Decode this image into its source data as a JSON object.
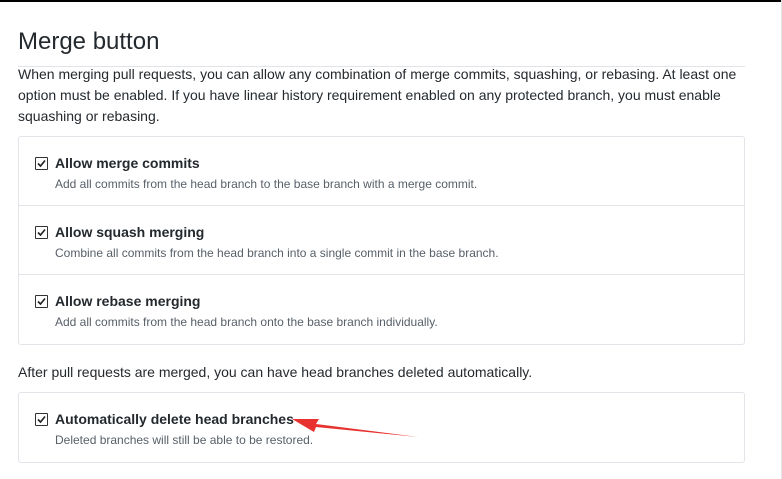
{
  "section": {
    "title": "Merge button",
    "description": "When merging pull requests, you can allow any combination of merge commits, squashing, or rebasing. At least one option must be enabled. If you have linear history requirement enabled on any protected branch, you must enable squashing or rebasing."
  },
  "merge_options": [
    {
      "label": "Allow merge commits",
      "note": "Add all commits from the head branch to the base branch with a merge commit.",
      "checked": true
    },
    {
      "label": "Allow squash merging",
      "note": "Combine all commits from the head branch into a single commit in the base branch.",
      "checked": true
    },
    {
      "label": "Allow rebase merging",
      "note": "Add all commits from the head branch onto the base branch individually.",
      "checked": true
    }
  ],
  "after_merge": {
    "text": "After pull requests are merged, you can have head branches deleted automatically.",
    "option": {
      "label": "Automatically delete head branches",
      "note": "Deleted branches will still be able to be restored.",
      "checked": true
    }
  },
  "colors": {
    "annotation_arrow": "#e8322f",
    "border": "#e1e4e8",
    "muted_text": "#586069"
  },
  "icons": {
    "checkbox_checked": "check-icon",
    "annotation": "arrow-icon"
  }
}
